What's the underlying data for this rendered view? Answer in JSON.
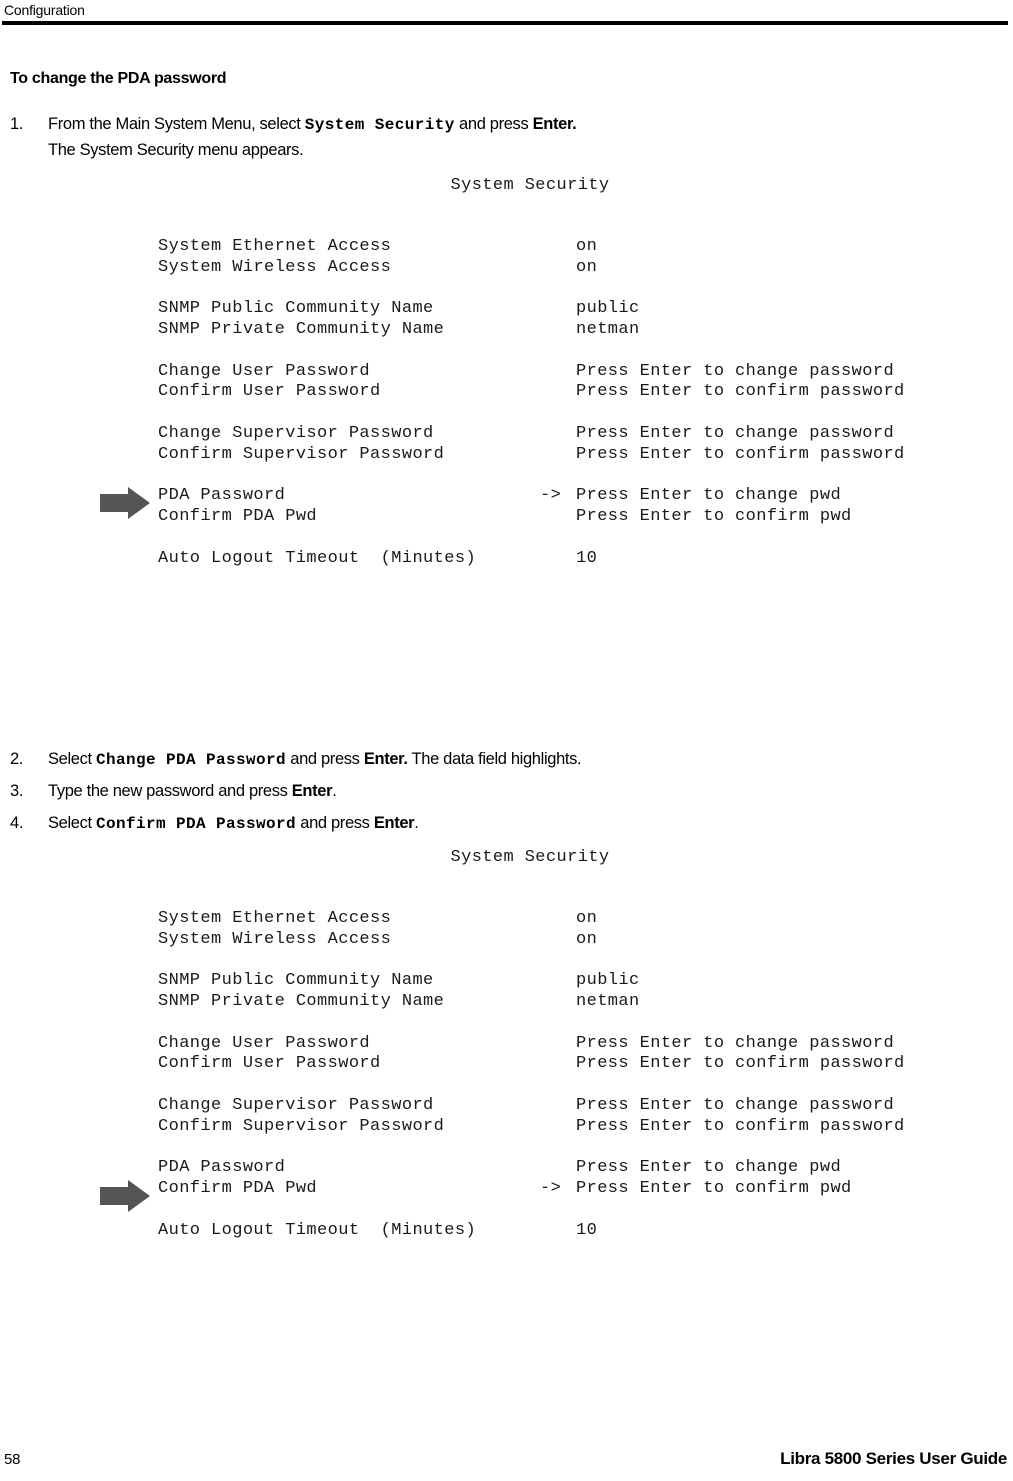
{
  "header": {
    "title": "Configuration"
  },
  "section": {
    "heading": "To change the PDA password"
  },
  "steps": [
    {
      "number": "1.",
      "text_before": "From the Main System Menu, select ",
      "mono": "System Security",
      "text_middle": " and press ",
      "bold": "Enter.",
      "text_after": "",
      "second_line": "The System Security menu appears."
    },
    {
      "number": "2.",
      "text_before": "Select ",
      "mono": "Change PDA Password",
      "text_middle": "  and press ",
      "bold": "Enter.",
      "text_after": " The data field highlights.",
      "second_line": ""
    },
    {
      "number": "3.",
      "text_before": "Type the new password and press ",
      "mono": "",
      "text_middle": "",
      "bold": "Enter",
      "text_after": ".",
      "second_line": ""
    },
    {
      "number": "4.",
      "text_before": "Select ",
      "mono": "Confirm PDA Password",
      "text_middle": " and press ",
      "bold": "Enter",
      "text_after": ".",
      "second_line": ""
    }
  ],
  "terminals": [
    {
      "title": "System Security",
      "selected_row": "PDA Password",
      "rows": [
        {
          "label": "System Ethernet Access",
          "marker": "",
          "value": "on"
        },
        {
          "label": "System Wireless Access",
          "marker": "",
          "value": "on"
        },
        {
          "label": "",
          "marker": "",
          "value": ""
        },
        {
          "label": "SNMP Public Community Name",
          "marker": "",
          "value": "public"
        },
        {
          "label": "SNMP Private Community Name",
          "marker": "",
          "value": "netman"
        },
        {
          "label": "",
          "marker": "",
          "value": ""
        },
        {
          "label": "Change User Password",
          "marker": "",
          "value": "Press Enter to change password"
        },
        {
          "label": "Confirm User Password",
          "marker": "",
          "value": "Press Enter to confirm password"
        },
        {
          "label": "",
          "marker": "",
          "value": ""
        },
        {
          "label": "Change Supervisor Password",
          "marker": "",
          "value": "Press Enter to change password"
        },
        {
          "label": "Confirm Supervisor Password",
          "marker": "",
          "value": "Press Enter to confirm password"
        },
        {
          "label": "",
          "marker": "",
          "value": ""
        },
        {
          "label": "PDA Password",
          "marker": "->",
          "value": "Press Enter to change pwd"
        },
        {
          "label": "Confirm PDA Pwd",
          "marker": "",
          "value": "Press Enter to confirm pwd"
        },
        {
          "label": "",
          "marker": "",
          "value": ""
        },
        {
          "label": "Auto Logout Timeout  (Minutes)",
          "marker": "",
          "value": "10"
        }
      ]
    },
    {
      "title": "System Security",
      "selected_row": "Confirm PDA Pwd",
      "rows": [
        {
          "label": "System Ethernet Access",
          "marker": "",
          "value": "on"
        },
        {
          "label": "System Wireless Access",
          "marker": "",
          "value": "on"
        },
        {
          "label": "",
          "marker": "",
          "value": ""
        },
        {
          "label": "SNMP Public Community Name",
          "marker": "",
          "value": "public"
        },
        {
          "label": "SNMP Private Community Name",
          "marker": "",
          "value": "netman"
        },
        {
          "label": "",
          "marker": "",
          "value": ""
        },
        {
          "label": "Change User Password",
          "marker": "",
          "value": "Press Enter to change password"
        },
        {
          "label": "Confirm User Password",
          "marker": "",
          "value": "Press Enter to confirm password"
        },
        {
          "label": "",
          "marker": "",
          "value": ""
        },
        {
          "label": "Change Supervisor Password",
          "marker": "",
          "value": "Press Enter to change password"
        },
        {
          "label": "Confirm Supervisor Password",
          "marker": "",
          "value": "Press Enter to confirm password"
        },
        {
          "label": "",
          "marker": "",
          "value": ""
        },
        {
          "label": "PDA Password",
          "marker": "",
          "value": "Press Enter to change pwd"
        },
        {
          "label": "Confirm PDA Pwd",
          "marker": "->",
          "value": "Press Enter to confirm pwd"
        },
        {
          "label": "",
          "marker": "",
          "value": ""
        },
        {
          "label": "Auto Logout Timeout  (Minutes)",
          "marker": "",
          "value": "10"
        }
      ]
    }
  ],
  "footer": {
    "page_number": "58",
    "guide_title": "Libra 5800 Series User Guide"
  },
  "colors": {
    "text": "#000000",
    "rule": "#000000",
    "arrow": "#555555",
    "terminal_text": "#1a1a1a"
  }
}
